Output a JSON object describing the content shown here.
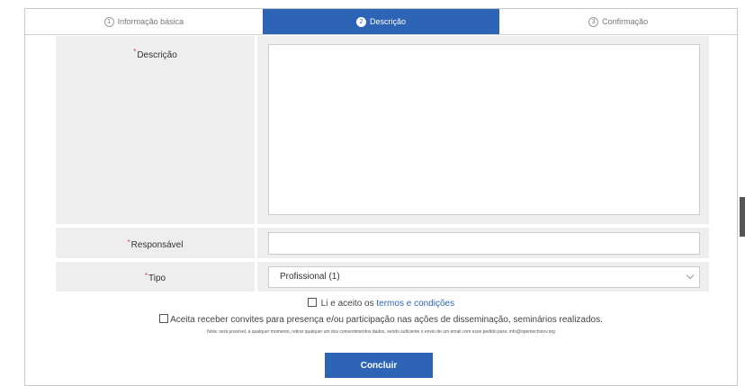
{
  "steps": [
    {
      "num": "1",
      "label": "Informação básica"
    },
    {
      "num": "2",
      "label": "Descrição"
    },
    {
      "num": "3",
      "label": "Confirmação"
    }
  ],
  "form": {
    "descricao_label": "Descrição",
    "descricao_value": "",
    "responsavel_label": "Responsável",
    "responsavel_value": "",
    "tipo_label": "Tipo",
    "tipo_value": "Profissional (1)",
    "required_mark": "*"
  },
  "consent": {
    "terms_prefix": "Li e aceito os",
    "terms_link": "termos e condições",
    "invites": "Aceita receber convites para presença e/ou participação nas ações de disseminação, seminários realizados.",
    "note": "Nota: será possível, a qualquer momento, retirar qualquer um dos consentimentos dados, sendo suficiente o envio de um email com esse pedido para: info@opentechinov.org"
  },
  "submit_label": "Concluir",
  "colors": {
    "accent": "#2e64b5",
    "required": "#e2394c",
    "panel": "#eeeeee"
  }
}
